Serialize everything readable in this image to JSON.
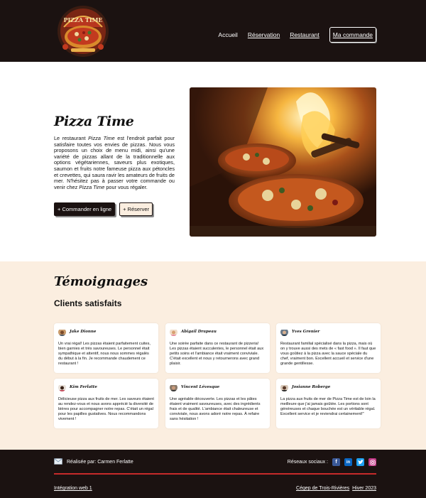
{
  "brand": {
    "logo_text": "PIZZA TIME"
  },
  "nav": {
    "items": [
      {
        "label": "Accueil"
      },
      {
        "label": "Réservation"
      },
      {
        "label": "Restaurant"
      },
      {
        "label": "Ma commande"
      }
    ]
  },
  "hero": {
    "title": "Pizza Time",
    "text_parts": [
      "Le restaurant ",
      "Pizza Time",
      " est l'endroit parfait pour satisfaire toutes vos envies de pizzas. Nous vous proposons un choix de menu midi, ainsi qu'une variété de pizzas allant de la traditionnelle aux options végétariennes, saveurs plus exotiques, saumon et fruits notre fameuse pizza aux pétoncles et crevettes, qui saura ravir les amateurs de fruits de mer. N'hésitez pas à passer votre commande ou venir chez ",
      "Pizza Time",
      " pour vous régaler."
    ],
    "buttons": {
      "order": "+ Commander en ligne",
      "reserve": "+ Réserver"
    }
  },
  "testimonials": {
    "title": "Témoignages",
    "subtitle": "Clients satisfaits",
    "cards": [
      {
        "name": "Jake Dionne",
        "text": "Un vrai régal! Les pizzas étaient parfaitement cuites, bien garnies et très savoureuses. Le personnel était sympathique et attentif, nous nous sommes régalés du début à la fin. Je recommande chaudement ce restaurant !"
      },
      {
        "name": "Abigail Drapeau",
        "text": "Une soirée parfaite dans ce restaurant de pizzeria! Les pizzas étaient succulentes, le personnel était aux petits soins et l'ambiance était vraiment conviviale. C'était excellent et nous y retournerons avec grand plaisir."
      },
      {
        "name": "Yves Grenier",
        "text": "Restaurant familial spécialisé dans la pizza, mais où on y trouve aussi des mets de « fast food ». Il faut que vous goûtiez à la pizza avec la sauce spéciale du chef, vraiment bon. Excellent accueil et service d'une grande gentillesse."
      },
      {
        "name": "Kim Ferlatte",
        "text": "Délicieuse pizza aux fruits de mer. Les saveurs étaient au rendez-vous et nous avons apprécié la diversité de bières pour accompagner notre repas. C'était un régal pour les papilles gustatives. Nous recommandons vivement !"
      },
      {
        "name": "Vincent Lévesque",
        "text": "Une agréable découverte. Les pizzas et les pâtes étaient vraiment savoureuses, avec des ingrédients frais et de qualité. L'ambiance était chaleureuse et conviviale, nous avons adoré notre repas. À refaire sans hésitation !"
      },
      {
        "name": "Josianne Roberge",
        "text": "La pizza aux fruits de mer de Pizza Time est de loin la meilleure que j'ai jamais goûtée. Les portions sont généreuses et chaque bouchée est un véritable régal. Excellent service et je reviendrai certainement!\""
      }
    ]
  },
  "footer": {
    "credit": "Réalisée par: Carmen Ferlatte",
    "social_label": "Réseaux sociaux :",
    "course": "Intégration web 1",
    "school": "Cégep de Trois-Rivières",
    "term": "Hiver 2023"
  }
}
